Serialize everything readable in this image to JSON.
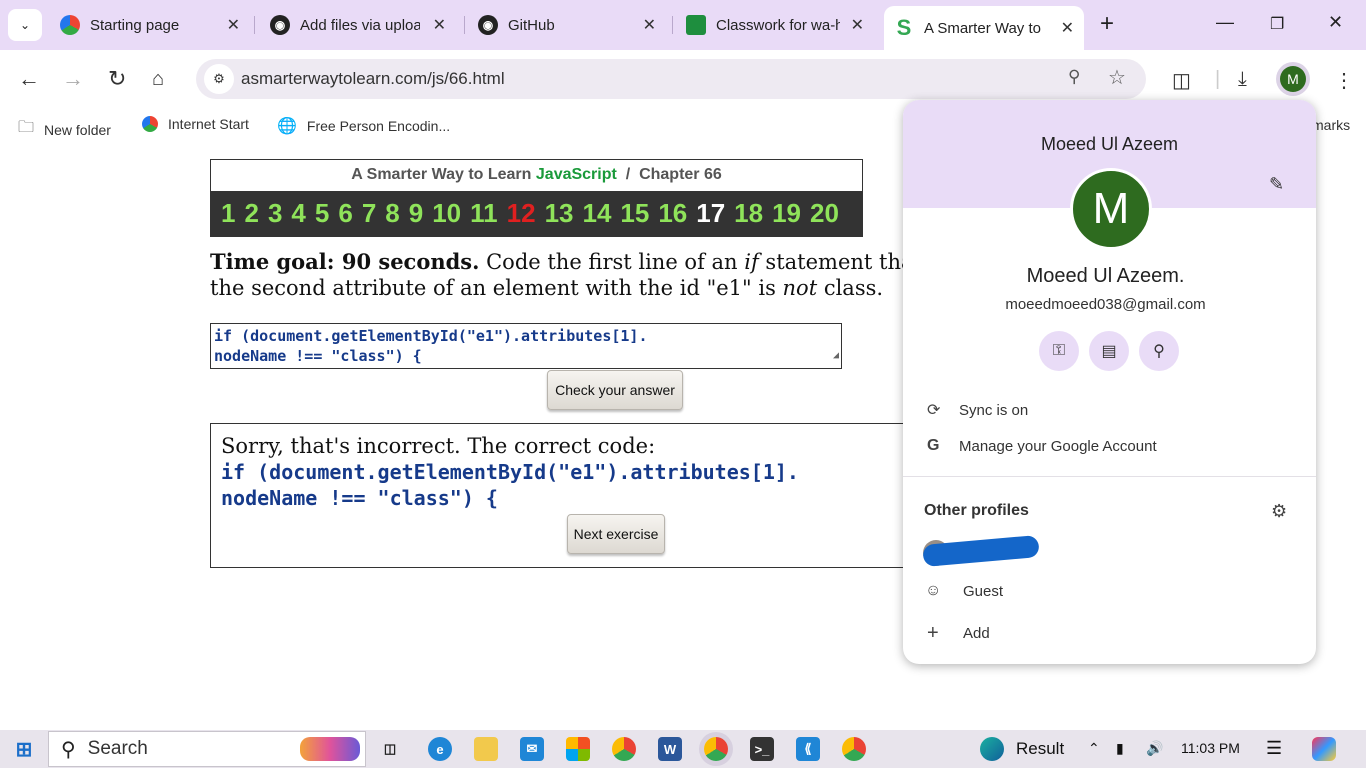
{
  "tabs": [
    {
      "title": "Starting page",
      "icon": "opera-icon",
      "color": "#e05a2b"
    },
    {
      "title": "Add files via upload",
      "icon": "github-icon",
      "color": "#222222"
    },
    {
      "title": "GitHub",
      "icon": "github-icon",
      "color": "#222222"
    },
    {
      "title": "Classwork for wa-h",
      "icon": "classroom-icon",
      "color": "#1e8e3e"
    },
    {
      "title": "A Smarter Way to",
      "icon": "smarter-way-icon",
      "color": "#34a853"
    }
  ],
  "tab_new": "+",
  "address": {
    "url": "asmarterwaytolearn.com/js/66.html"
  },
  "profile_initial": "M",
  "bookmarks": [
    {
      "label": "New folder",
      "icon": "folder-icon"
    },
    {
      "label": "Internet Start",
      "icon": "internet-start-icon"
    },
    {
      "label": "Free Person Encodin...",
      "icon": "globe-icon"
    }
  ],
  "bookmarks_overflow": "marks",
  "page": {
    "title_prefix": "A Smarter Way to Learn",
    "title_js": "JavaScript",
    "title_sep": "/",
    "chapter": "Chapter 66",
    "chapters": [
      "1",
      "2",
      "3",
      "4",
      "5",
      "6",
      "7",
      "8",
      "9",
      "10",
      "11",
      "12",
      "13",
      "14",
      "15",
      "16",
      "17",
      "18",
      "19",
      "20"
    ],
    "red_chapter": "12",
    "white_chapter": "17",
    "goal_bold": "Time goal: 90 seconds.",
    "goal_a": " Code the first line of an ",
    "goal_if": "if",
    "goal_b": " statement that te",
    "goal_line2_a": "the second attribute of an element with the id \"e1\" is ",
    "goal_not": "not",
    "goal_line2_b": " class.",
    "answer_line1": "if (document.getElementById(\"e1\").attributes[1].",
    "answer_line2": "nodeName !== \"class\") {",
    "check_button": "Check your answer",
    "sorry_text": "Sorry, that's incorrect. The correct code:",
    "code_line1": "if (document.getElementById(\"e1\").attributes[1].",
    "code_line2": "nodeName !== \"class\") {",
    "next_button": "Next exercise"
  },
  "profile_popup": {
    "name": "Moeed Ul Azeem",
    "initial": "M",
    "full_name": "Moeed Ul Azeem.",
    "email": "moeedmoeed038@gmail.com",
    "sync": "Sync is on",
    "manage": "Manage your Google Account",
    "other_profiles": "Other profiles",
    "guest": "Guest",
    "add": "Add"
  },
  "taskbar": {
    "search": "Search",
    "weather": "Result",
    "time": "11:03 PM"
  }
}
